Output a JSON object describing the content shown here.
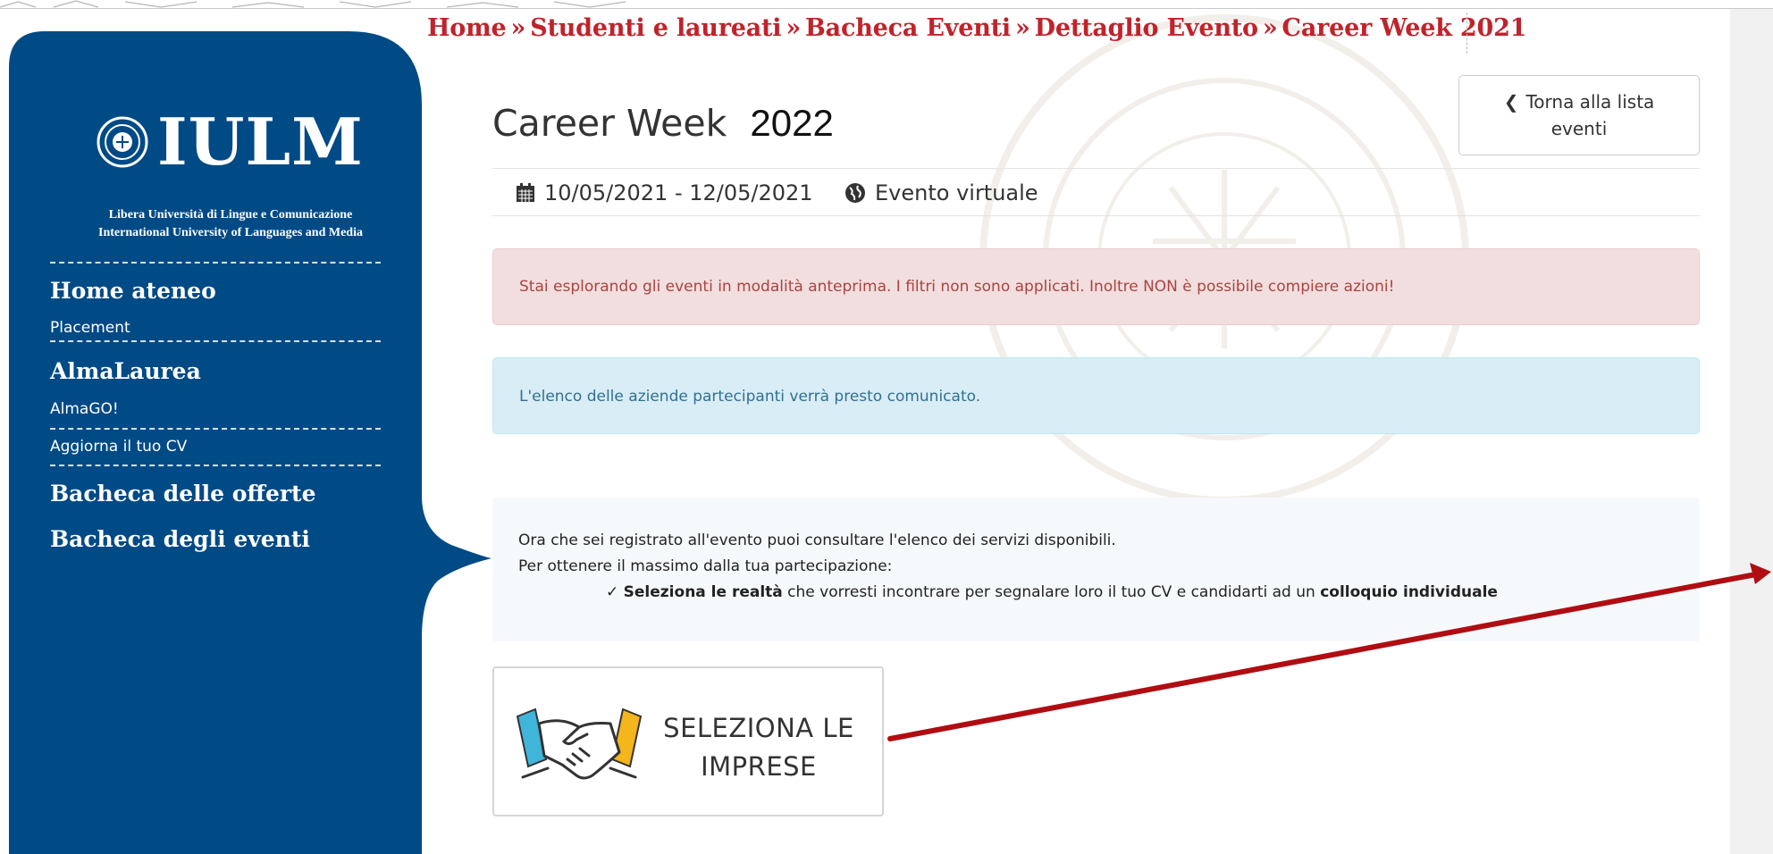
{
  "breadcrumb": {
    "items": [
      "Home",
      "Studenti e laureati",
      "Bacheca Eventi",
      "Dettaglio Evento",
      "Career Week 2021"
    ],
    "separator": "»"
  },
  "sidebar": {
    "logo_text": "IULM",
    "logo_subtitle_1": "Libera Università di Lingue e Comunicazione",
    "logo_subtitle_2": "International University of Languages and Media",
    "items": [
      {
        "label": "Home ateneo",
        "kind": "main"
      },
      {
        "label": "Placement",
        "kind": "sub"
      },
      {
        "label": "AlmaLaurea",
        "kind": "main"
      },
      {
        "label": "AlmaGO!",
        "kind": "sub"
      },
      {
        "label": "Aggiorna il tuo CV",
        "kind": "sub"
      },
      {
        "label": "Bacheca delle offerte",
        "kind": "main"
      },
      {
        "label": "Bacheca degli eventi",
        "kind": "main"
      }
    ],
    "color": "#004a86"
  },
  "event": {
    "title": "Career Week",
    "year_overlay": "2022",
    "dates": "10/05/2021 - 12/05/2021",
    "location": "Evento virtuale"
  },
  "back_button": {
    "label_line1": "Torna alla lista",
    "label_line2": "eventi"
  },
  "alerts": {
    "preview": "Stai esplorando gli eventi in modalità anteprima. I filtri non sono applicati. Inoltre NON è possibile compiere azioni!",
    "companies": "L'elenco delle aziende partecipanti verrà presto comunicato."
  },
  "info": {
    "line1": "Ora che sei registrato all'evento puoi consultare l'elenco dei servizi disponibili.",
    "line2": "Per ottenere il massimo dalla tua partecipazione:",
    "check": "✓",
    "bullet_bold1": "Seleziona le realtà",
    "bullet_mid": " che vorresti incontrare per segnalare loro il tuo CV e candidarti ad un ",
    "bullet_bold2": "colloquio individuale"
  },
  "select_button": {
    "line1": "SELEZIONA LE",
    "line2": "IMPRESE",
    "icon": "handshake-icon"
  },
  "colors": {
    "breadcrumb": "#c0232b",
    "arrow": "#b00d12"
  }
}
